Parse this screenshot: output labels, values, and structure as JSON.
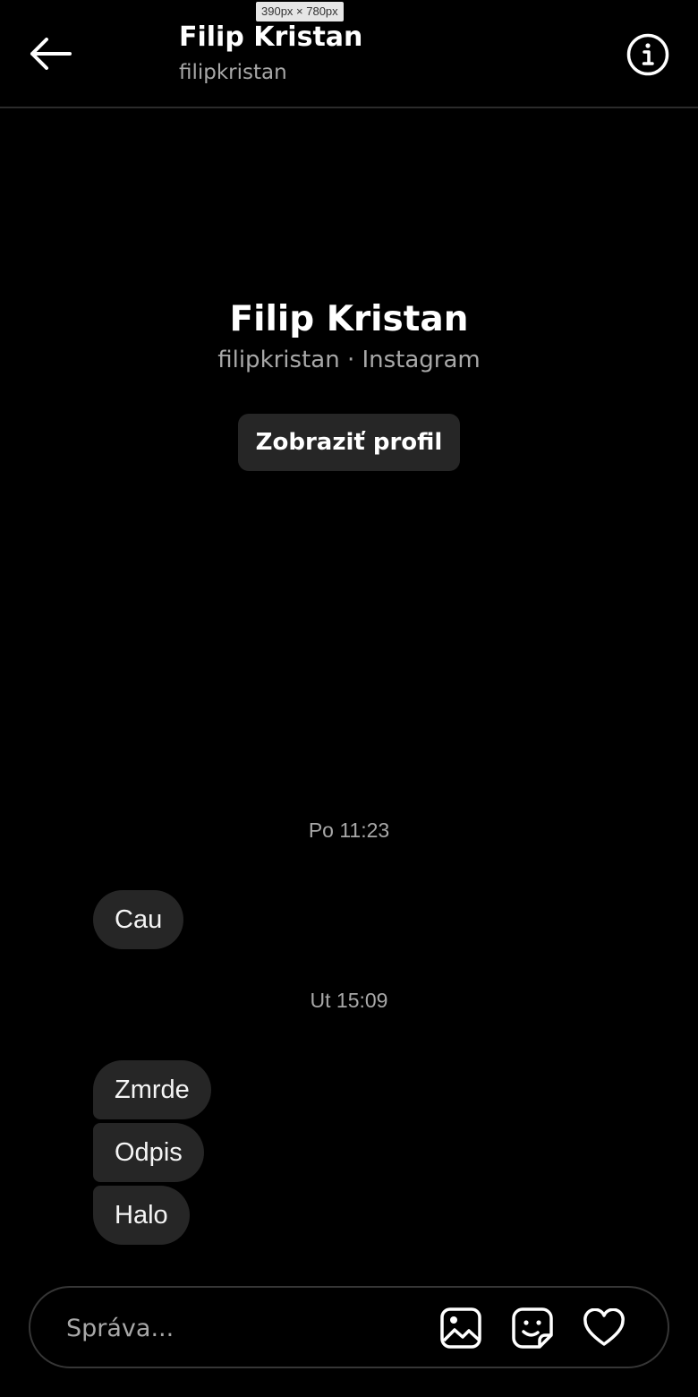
{
  "devtools": {
    "size_label": "390px × 780px"
  },
  "header": {
    "name": "Filip Kristan",
    "username": "filipkristan"
  },
  "profile": {
    "name": "Filip Kristan",
    "meta": "filipkristan · Instagram",
    "view_profile_label": "Zobraziť profil"
  },
  "messages": [
    {
      "timestamp": "Po 11:23",
      "bubbles": [
        "Cau"
      ]
    },
    {
      "timestamp": "Ut 15:09",
      "bubbles": [
        "Zmrde",
        "Odpis",
        "Halo"
      ]
    }
  ],
  "composer": {
    "placeholder": "Správa...",
    "icons": [
      "image-icon",
      "sticker-icon",
      "heart-icon"
    ]
  },
  "colors": {
    "background": "#000000",
    "bubble": "#262626",
    "secondary_text": "#a8a8a8"
  }
}
